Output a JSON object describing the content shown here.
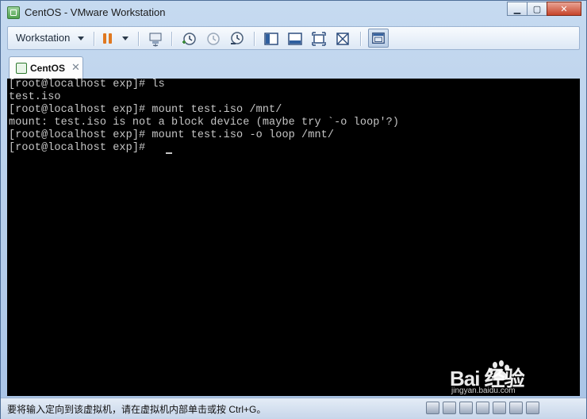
{
  "window": {
    "title": "CentOS - VMware Workstation",
    "controls": {
      "minimize": "▁",
      "maximize": "▢",
      "close": "✕"
    }
  },
  "toolbar": {
    "workstation_label": "Workstation",
    "icons": [
      "pause-icon",
      "send-ctrl-alt-del-icon",
      "snapshot-icon",
      "revert-snapshot-icon",
      "snapshot-manager-icon",
      "sidebar-view-icon",
      "console-view-icon",
      "fullscreen-icon",
      "unity-icon",
      "library-icon"
    ]
  },
  "tabs": [
    {
      "label": "CentOS",
      "close": "✕"
    }
  ],
  "console": {
    "lines": [
      "[root@localhost exp]# ls",
      "test.iso",
      "[root@localhost exp]# mount test.iso /mnt/",
      "mount: test.iso is not a block device (maybe try `-o loop'?)",
      "[root@localhost exp]# mount test.iso -o loop /mnt/",
      "[root@localhost exp]# "
    ]
  },
  "watermark": {
    "text": "Bai  经验",
    "sub": "jingyan.baidu.com"
  },
  "statusbar": {
    "message": "要将输入定向到该虚拟机，请在虚拟机内部单击或按 Ctrl+G。",
    "icons": [
      "hard-disk-icon",
      "cd-drive-icon",
      "network-icon",
      "usb-icon",
      "printer-icon",
      "sound-icon",
      "display-icon"
    ]
  },
  "colors": {
    "accent_pause": "#e07820",
    "console_bg": "#000000",
    "console_fg": "#c6c6c6"
  }
}
